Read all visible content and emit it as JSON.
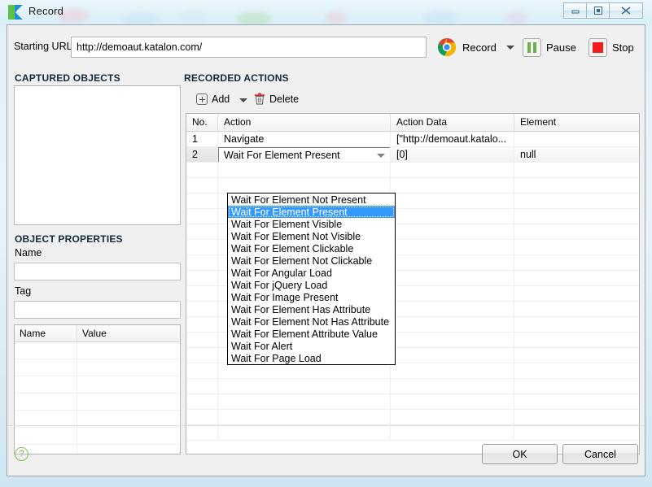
{
  "window": {
    "title": "Record",
    "logo_icon": "katalon-k-logo",
    "controls": {
      "minimize": "minimize-icon",
      "maximize": "restore-icon",
      "close": "close-icon"
    }
  },
  "toolbar": {
    "url_label": "Starting URL",
    "url_value": "http://demoaut.katalon.com/",
    "url_placeholder": "",
    "browser_icon": "chrome-icon",
    "record_label": "Record",
    "record_caret_icon": "chevron-down-icon",
    "pause_label": "Pause",
    "pause_icon": "pause-icon",
    "stop_label": "Stop",
    "stop_icon": "stop-icon"
  },
  "captured_objects": {
    "heading": "CAPTURED OBJECTS",
    "items": []
  },
  "object_properties": {
    "heading": "OBJECT PROPERTIES",
    "name_label": "Name",
    "name_value": "",
    "tag_label": "Tag",
    "tag_value": "",
    "table": {
      "columns": [
        "Name",
        "Value"
      ],
      "rows": []
    }
  },
  "recorded_actions": {
    "heading": "RECORDED ACTIONS",
    "toolbar": {
      "add_label": "Add",
      "add_icon": "plus-circle-icon",
      "add_caret_icon": "chevron-down-icon",
      "delete_label": "Delete",
      "delete_icon": "trash-icon"
    },
    "columns": [
      "No.",
      "Action",
      "Action Data",
      "Element"
    ],
    "rows": [
      {
        "no": "1",
        "action": "Navigate",
        "action_data": "[\"http://demoaut.katalo...",
        "element": ""
      },
      {
        "no": "2",
        "action": "Wait For Element Present",
        "action_data": "[0]",
        "element": "null"
      }
    ],
    "editing_row_index": 1,
    "combo_value": "Wait For Element Present",
    "combo_arrow_icon": "chevron-down-icon",
    "dropdown_open": true,
    "dropdown_selected": "Wait For Element Present",
    "dropdown_options": [
      "Wait For Element Not Present",
      "Wait For Element Present",
      "Wait For Element Visible",
      "Wait For Element Not Visible",
      "Wait For Element Clickable",
      "Wait For Element Not Clickable",
      "Wait For Angular Load",
      "Wait For jQuery Load",
      "Wait For Image Present",
      "Wait For Element Has Attribute",
      "Wait For Element Not Has Attribute",
      "Wait For Element Attribute Value",
      "Wait For Alert",
      "Wait For Page Load"
    ]
  },
  "footer": {
    "help_icon": "help-question-icon",
    "help_glyph": "?",
    "ok_label": "OK",
    "cancel_label": "Cancel"
  },
  "colors": {
    "selection_blue": "#3399ff",
    "heading_navy": "#13293d",
    "pause_green": "#6ab04c",
    "stop_red": "#f21d1d",
    "help_green": "#6aab3c"
  }
}
